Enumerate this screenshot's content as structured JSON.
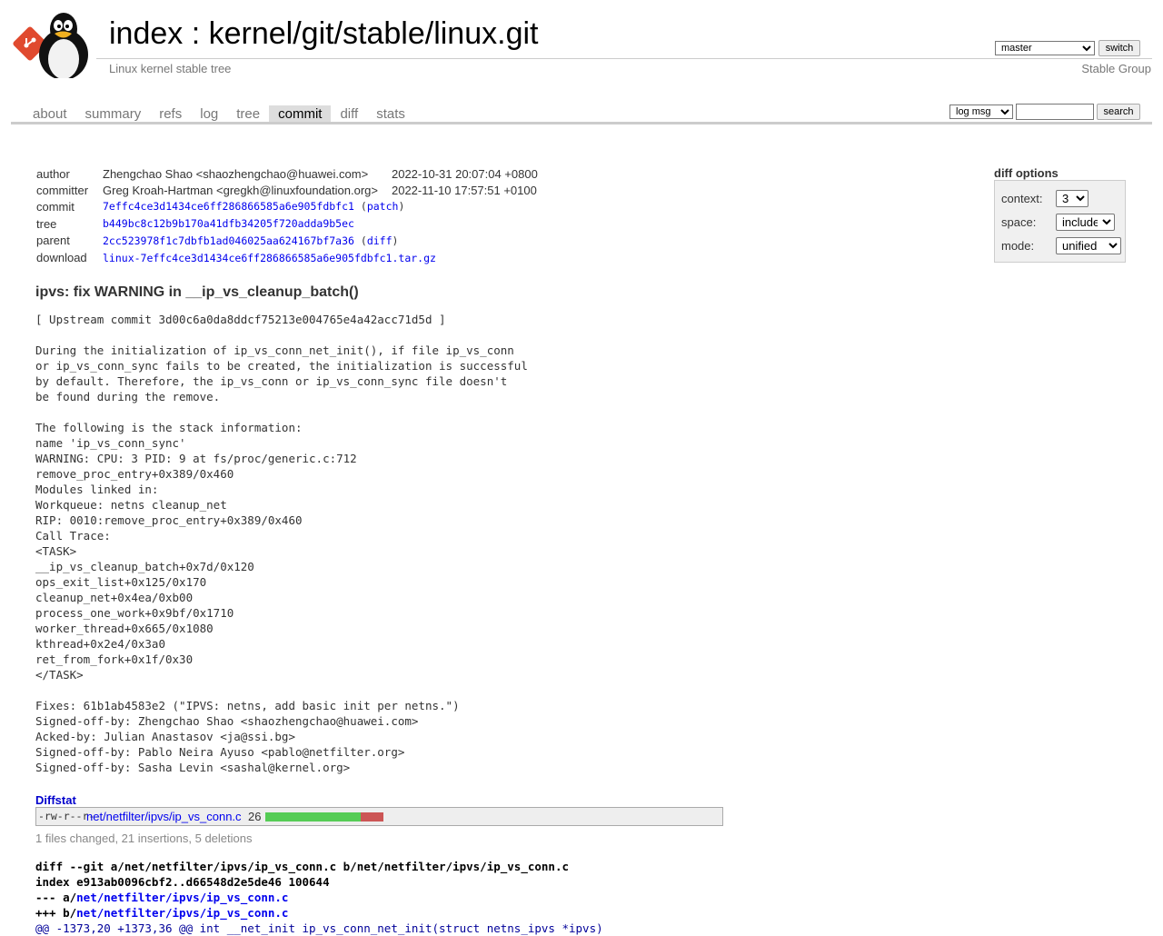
{
  "header": {
    "index_label": "index",
    "separator": " : ",
    "repo_path": "kernel/git/stable/linux.git",
    "description": "Linux kernel stable tree",
    "owner": "Stable Group",
    "branch_selected": "master",
    "switch_label": "switch"
  },
  "tabs": [
    {
      "label": "about",
      "active": false
    },
    {
      "label": "summary",
      "active": false
    },
    {
      "label": "refs",
      "active": false
    },
    {
      "label": "log",
      "active": false
    },
    {
      "label": "tree",
      "active": false
    },
    {
      "label": "commit",
      "active": true
    },
    {
      "label": "diff",
      "active": false
    },
    {
      "label": "stats",
      "active": false
    }
  ],
  "search": {
    "select_value": "log msg",
    "input_value": "",
    "button_label": "search"
  },
  "commit_info": {
    "author": {
      "label": "author",
      "value": "Zhengchao Shao <shaozhengchao@huawei.com>",
      "date": "2022-10-31 20:07:04 +0800"
    },
    "committer": {
      "label": "committer",
      "value": "Greg Kroah-Hartman <gregkh@linuxfoundation.org>",
      "date": "2022-11-10 17:57:51 +0100"
    },
    "commit": {
      "label": "commit",
      "sha": "7effc4ce3d1434ce6ff286866585a6e905fdbfc1",
      "open": " (",
      "link": "patch",
      "close": ")"
    },
    "tree": {
      "label": "tree",
      "sha": "b449bc8c12b9b170a41dfb34205f720adda9b5ec"
    },
    "parent": {
      "label": "parent",
      "sha": "2cc523978f1c7dbfb1ad046025aa624167bf7a36",
      "open": " (",
      "link": "diff",
      "close": ")"
    },
    "download": {
      "label": "download",
      "file": "linux-7effc4ce3d1434ce6ff286866585a6e905fdbfc1.tar.gz"
    }
  },
  "diff_options": {
    "title": "diff options",
    "context_label": "context:",
    "context_value": "3",
    "space_label": "space:",
    "space_value": "include",
    "mode_label": "mode:",
    "mode_value": "unified"
  },
  "commit_subject": "ipvs: fix WARNING in __ip_vs_cleanup_batch()",
  "commit_message": "[ Upstream commit 3d00c6a0da8ddcf75213e004765e4a42acc71d5d ]\n\nDuring the initialization of ip_vs_conn_net_init(), if file ip_vs_conn\nor ip_vs_conn_sync fails to be created, the initialization is successful\nby default. Therefore, the ip_vs_conn or ip_vs_conn_sync file doesn't\nbe found during the remove.\n\nThe following is the stack information:\nname 'ip_vs_conn_sync'\nWARNING: CPU: 3 PID: 9 at fs/proc/generic.c:712\nremove_proc_entry+0x389/0x460\nModules linked in:\nWorkqueue: netns cleanup_net\nRIP: 0010:remove_proc_entry+0x389/0x460\nCall Trace:\n<TASK>\n__ip_vs_cleanup_batch+0x7d/0x120\nops_exit_list+0x125/0x170\ncleanup_net+0x4ea/0xb00\nprocess_one_work+0x9bf/0x1710\nworker_thread+0x665/0x1080\nkthread+0x2e4/0x3a0\nret_from_fork+0x1f/0x30\n</TASK>\n\nFixes: 61b1ab4583e2 (\"IPVS: netns, add basic init per netns.\")\nSigned-off-by: Zhengchao Shao <shaozhengchao@huawei.com>\nAcked-by: Julian Anastasov <ja@ssi.bg>\nSigned-off-by: Pablo Neira Ayuso <pablo@netfilter.org>\nSigned-off-by: Sasha Levin <sashal@kernel.org>",
  "diffstat": {
    "header": "Diffstat",
    "mode": "-rw-r--r--",
    "file": "net/netfilter/ipvs/ip_vs_conn.c",
    "changes": "26",
    "insertions": 21,
    "deletions": 5,
    "summary": "1 files changed, 21 insertions, 5 deletions",
    "add_color": "#55cc55",
    "del_color": "#cc5555"
  },
  "diff": {
    "git_line": "diff --git a/net/netfilter/ipvs/ip_vs_conn.c b/net/netfilter/ipvs/ip_vs_conn.c",
    "index_line": "index e913ab0096cbf2..d66548d2e5de46 100644",
    "minus_prefix": "--- a/",
    "minus_file": "net/netfilter/ipvs/ip_vs_conn.c",
    "plus_prefix": "+++ b/",
    "plus_file": "net/netfilter/ipvs/ip_vs_conn.c",
    "hunk_line": "@@ -1373,20 +1373,36 @@ int __net_init ip_vs_conn_net_init(struct netns_ipvs *ipvs)"
  }
}
